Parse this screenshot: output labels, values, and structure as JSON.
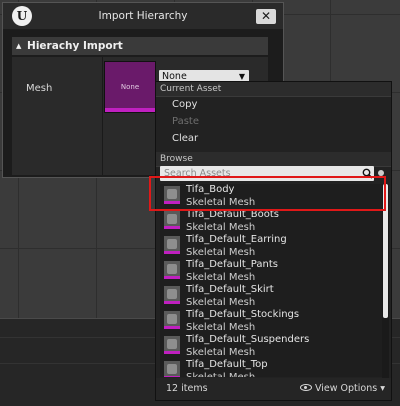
{
  "window": {
    "logo": "U",
    "title": "Import Hierarchy",
    "close_label": "✕",
    "section_title": "Hierachy Import"
  },
  "property": {
    "label": "Mesh",
    "thumbnail_label": "None",
    "combo_value": "None"
  },
  "menu": {
    "current_asset_header": "Current Asset",
    "copy": "Copy",
    "paste": "Paste",
    "clear": "Clear",
    "browse_header": "Browse",
    "search_placeholder": "Search Assets",
    "assets": [
      {
        "name": "Tifa_Body",
        "type": "Skeletal Mesh"
      },
      {
        "name": "Tifa_Default_Boots",
        "type": "Skeletal Mesh"
      },
      {
        "name": "Tifa_Default_Earring",
        "type": "Skeletal Mesh"
      },
      {
        "name": "Tifa_Default_Pants",
        "type": "Skeletal Mesh"
      },
      {
        "name": "Tifa_Default_Skirt",
        "type": "Skeletal Mesh"
      },
      {
        "name": "Tifa_Default_Stockings",
        "type": "Skeletal Mesh"
      },
      {
        "name": "Tifa_Default_Suspenders",
        "type": "Skeletal Mesh"
      },
      {
        "name": "Tifa_Default_Top",
        "type": "Skeletal Mesh"
      }
    ],
    "item_count": "12 items",
    "view_options": "View Options"
  },
  "colors": {
    "accent_magenta": "#c020c0",
    "highlight_red": "#e01818"
  }
}
